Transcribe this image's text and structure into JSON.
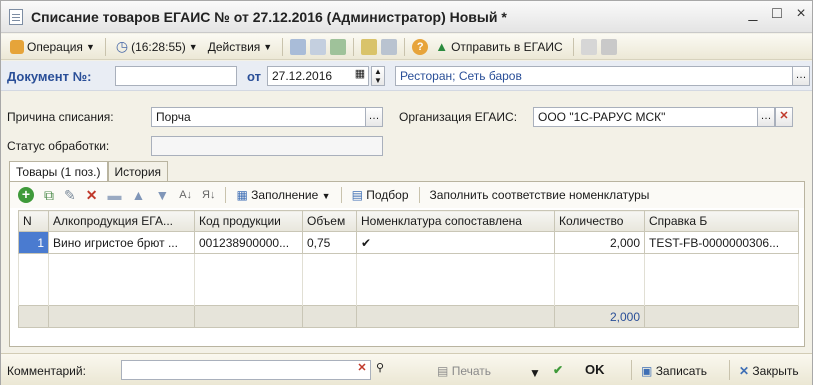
{
  "window": {
    "title": "Списание товаров ЕГАИС № от 27.12.2016 (Администратор) Новый *",
    "controls": [
      "_",
      "□",
      "×"
    ]
  },
  "toolbar": {
    "operation": "Операция",
    "time": "(16:28:55)",
    "actions": "Действия",
    "send": "Отправить в ЕГАИС"
  },
  "header": {
    "doc_label": "Документ №:",
    "doc_number": "",
    "from_label": "от",
    "date": "27.12.2016",
    "org_link": "Ресторан; Сеть баров"
  },
  "form": {
    "reason_label": "Причина списания:",
    "reason_value": "Порча",
    "egais_org_label": "Организация ЕГАИС:",
    "egais_org_value": "ООО \"1С-РАРУС МСК\"",
    "status_label": "Статус обработки:",
    "status_value": ""
  },
  "tabs": [
    {
      "label": "Товары (1 поз.)"
    },
    {
      "label": "История"
    }
  ],
  "grid_toolbar": {
    "fill": "Заполнение",
    "select": "Подбор",
    "match": "Заполнить соответствие номенклатуры"
  },
  "table": {
    "columns": [
      "N",
      "Алкопродукция ЕГА...",
      "Код продукции",
      "Объем",
      "Номенклатура сопоставлена",
      "Количество",
      "Справка Б"
    ],
    "rows": [
      {
        "n": "1",
        "product": "Вино игристое брют ...",
        "code": "001238900000...",
        "volume": "0,75",
        "matched": "✔",
        "qty": "2,000",
        "ref_b": "TEST-FB-0000000306..."
      }
    ],
    "total_qty": "2,000"
  },
  "bottom": {
    "comment_label": "Комментарий:",
    "comment_value": "",
    "print": "Печать",
    "ok": "OK",
    "save": "Записать",
    "close": "Закрыть"
  }
}
